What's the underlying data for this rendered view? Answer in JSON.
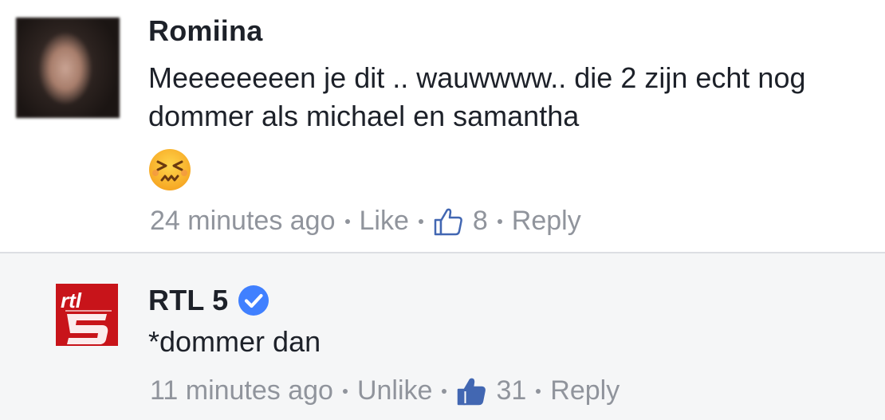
{
  "comments": [
    {
      "author": "Romiina",
      "text": "Meeeeeeeen je dit .. wauwwww.. die 2 zijn echt nog dommer als michael en samantha",
      "emoji": "persevering-face-emoji",
      "timestamp": "24 minutes ago",
      "like_label": "Like",
      "like_count": "8",
      "reply_label": "Reply"
    },
    {
      "author": "RTL 5",
      "verified": true,
      "text": "*dommer dan",
      "timestamp": "11 minutes ago",
      "like_label": "Unlike",
      "like_count": "31",
      "reply_label": "Reply"
    }
  ],
  "icons": {
    "like": "thumbs-up-icon",
    "verified": "verified-badge-icon"
  },
  "colors": {
    "text": "#1d2129",
    "meta": "#90949c",
    "like_blue": "#4267b2",
    "verified_blue": "#4080ff",
    "reply_background": "#f5f6f7",
    "rtl_red": "#d32027"
  }
}
